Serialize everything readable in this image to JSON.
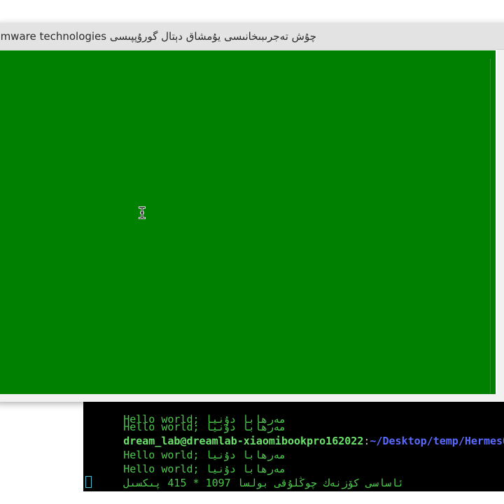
{
  "app_window": {
    "title": "چۇش تەجرىبىخانىسى يۇمشاق دېتال گورۇپپىسى Dreamware technologies"
  },
  "terminal": {
    "lines": [
      {
        "text": "Hello world; مەرھابا دۇنيا"
      },
      {
        "prompt_user": "dream_lab@dreamlab-xiaomibookpro162022",
        "prompt_sep": ":",
        "prompt_path": "~/Desktop/temp/HermesQt$"
      },
      {
        "text": "Hello world; مەرھابا دۇنيا"
      },
      {
        "text": "Hello world; مەرھابا دۇنيا"
      },
      {
        "text": "ئاساسى كۆزنەك چوڭلۇقى بولسا 1097 * 415 پىكسىل"
      }
    ]
  },
  "colors": {
    "canvas": "#008000",
    "terminal_bg": "#000000",
    "terminal_text": "#4cc94c",
    "prompt_path": "#5c6bff"
  },
  "icons": {
    "mouse_cursor": "ibeam-cursor-icon",
    "terminal_cursor": "block-cursor-icon"
  }
}
